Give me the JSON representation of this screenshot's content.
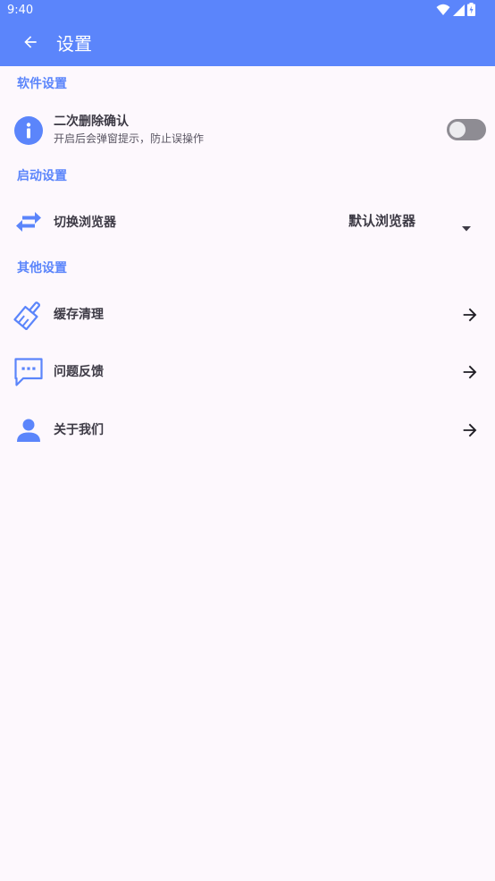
{
  "status_bar": {
    "time": "9:40",
    "icons": [
      "wifi-icon",
      "signal-icon",
      "battery-charging-icon"
    ]
  },
  "app_bar": {
    "back_icon": "arrow-back-icon",
    "title": "设置"
  },
  "sections": {
    "software": {
      "header": "软件设置",
      "items": {
        "double_delete_confirm": {
          "icon": "info-icon",
          "title": "二次删除确认",
          "subtitle": "开启后会弹窗提示，防止误操作",
          "enabled": false
        }
      }
    },
    "startup": {
      "header": "启动设置",
      "items": {
        "switch_browser": {
          "icon": "swap-horizontal-icon",
          "title": "切换浏览器",
          "selected_value": "默认浏览器"
        }
      }
    },
    "other": {
      "header": "其他设置",
      "items": {
        "clear_cache": {
          "icon": "broom-icon",
          "title": "缓存清理"
        },
        "feedback": {
          "icon": "chat-dots-icon",
          "title": "问题反馈"
        },
        "about": {
          "icon": "person-icon",
          "title": "关于我们"
        }
      }
    }
  },
  "colors": {
    "primary": "#5b85fb",
    "background": "#fdf8fd",
    "text": "#3d3a45",
    "toggle_off": "#8e8c93"
  }
}
